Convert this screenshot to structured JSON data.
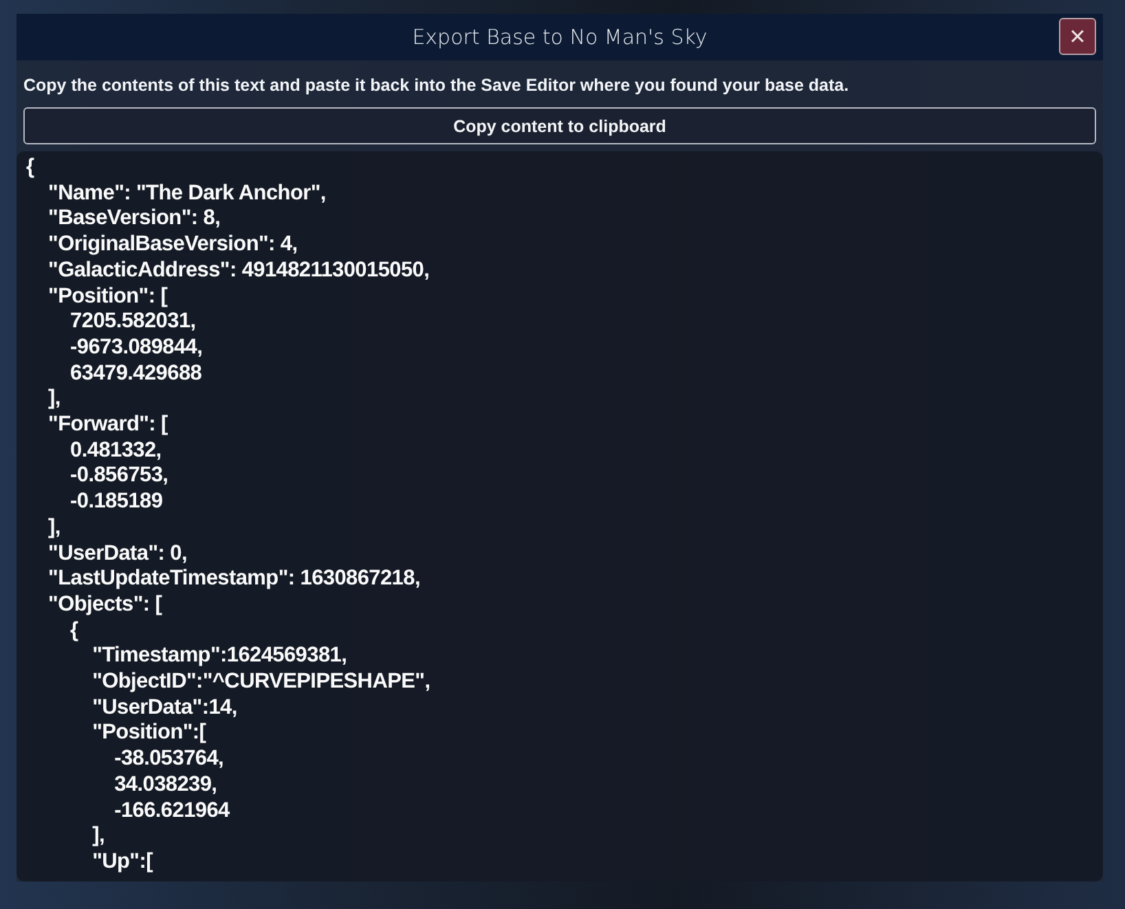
{
  "window": {
    "title": "Export Base to No Man's Sky",
    "close_label": "×"
  },
  "instructions": "Copy the contents of this text and paste it back into the Save Editor where you found your base data.",
  "copy_button": "Copy content to clipboard",
  "code_lines": [
    "{",
    "    \"Name\": \"The Dark Anchor\",",
    "    \"BaseVersion\": 8,",
    "    \"OriginalBaseVersion\": 4,",
    "    \"GalacticAddress\": 4914821130015050,",
    "    \"Position\": [",
    "        7205.582031,",
    "        -9673.089844,",
    "        63479.429688",
    "    ],",
    "    \"Forward\": [",
    "        0.481332,",
    "        -0.856753,",
    "        -0.185189",
    "    ],",
    "    \"UserData\": 0,",
    "    \"LastUpdateTimestamp\": 1630867218,",
    "    \"Objects\": [",
    "        {",
    "            \"Timestamp\":1624569381,",
    "            \"ObjectID\":\"^CURVEPIPESHAPE\",",
    "            \"UserData\":14,",
    "            \"Position\":[",
    "                -38.053764,",
    "                34.038239,",
    "                -166.621964",
    "            ],",
    "            \"Up\":["
  ]
}
